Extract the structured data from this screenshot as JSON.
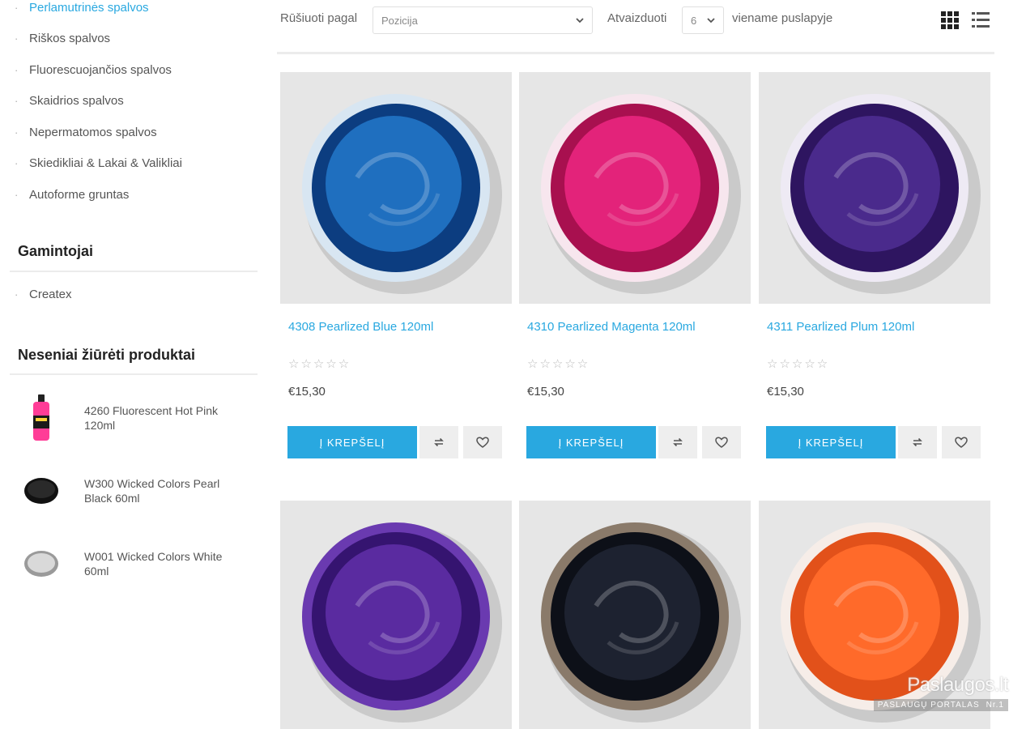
{
  "sidebar": {
    "categories": [
      {
        "label": "Perlamutrinės spalvos",
        "active": true
      },
      {
        "label": "Riškos spalvos",
        "active": false
      },
      {
        "label": "Fluorescuojančios spalvos",
        "active": false
      },
      {
        "label": "Skaidrios spalvos",
        "active": false
      },
      {
        "label": "Nepermatomos spalvos",
        "active": false
      },
      {
        "label": "Skiedikliai & Lakai & Valikliai",
        "active": false
      },
      {
        "label": "Autoforme gruntas",
        "active": false
      }
    ],
    "manufacturers_title": "Gamintojai",
    "manufacturers": [
      "Createx"
    ],
    "recent_title": "Neseniai žiūrėti produktai",
    "recent": [
      {
        "name": "4260 Fluorescent Hot Pink 120ml",
        "thumb": "bottle"
      },
      {
        "name": "W300 Wicked Colors Pearl Black 60ml",
        "thumb": "black-disc"
      },
      {
        "name": "W001 Wicked Colors White 60ml",
        "thumb": "white-disc"
      }
    ]
  },
  "toolbar": {
    "sort_label": "Rūšiuoti pagal",
    "sort_value": "Pozicija",
    "show_label": "Atvaizduoti",
    "show_value": "6",
    "per_page_label": "viename puslapyje"
  },
  "products": [
    {
      "name": "4308 Pearlized Blue 120ml",
      "price": "€15,30",
      "rating": 0,
      "color": "#1f6fbf",
      "dark": "#0c3d80",
      "rim": "#d8e6f2"
    },
    {
      "name": "4310 Pearlized Magenta 120ml",
      "price": "€15,30",
      "rating": 0,
      "color": "#e3237a",
      "dark": "#a8104f",
      "rim": "#f7e6ee"
    },
    {
      "name": "4311 Pearlized Plum 120ml",
      "price": "€15,30",
      "rating": 0,
      "color": "#4a2a8c",
      "dark": "#2e1560",
      "rim": "#eeeaf4"
    },
    {
      "name": "",
      "price": "",
      "rating": 0,
      "color": "#5a2ba0",
      "dark": "#351470",
      "rim": "#6a3ab0"
    },
    {
      "name": "",
      "price": "",
      "rating": 0,
      "color": "#1d2230",
      "dark": "#0d1018",
      "rim": "#8a7a6a"
    },
    {
      "name": "",
      "price": "",
      "rating": 0,
      "color": "#ff6a2a",
      "dark": "#e2511a",
      "rim": "#f6ede8"
    }
  ],
  "card_actions": {
    "cart_label": "Į KREPŠELĮ",
    "compare_icon": "compare-icon",
    "wishlist_icon": "heart-icon"
  },
  "watermark": {
    "title": "Paslaugos.lt",
    "subtitle": "PASLAUGŲ PORTALAS",
    "badge": "Nr.1"
  },
  "colors": {
    "accent": "#29a8e0",
    "card_bg": "#e6e6e6",
    "button_gray": "#eeeeee"
  }
}
